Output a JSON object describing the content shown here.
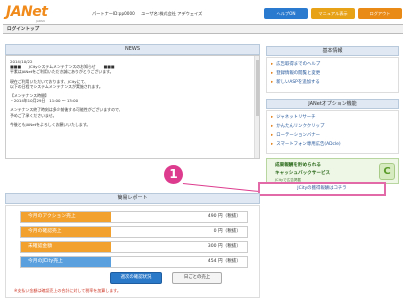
{
  "header": {
    "logo_main": "JANet",
    "logo_sub1": "JAPAN",
    "logo_sub2": "AFFILIATE NETWORK",
    "partner_label": "パートナーID:pp0000",
    "user_label": "ユーザ名:株式会社 アデウェイズ",
    "help_button": "ヘルプON",
    "manual_button": "マニュアル表示",
    "logout_button": "ログアウト"
  },
  "tabbar": {
    "active_tab": "ログイントップ"
  },
  "news": {
    "title": "NEWS",
    "lines": [
      "2014/10/22",
      "■■■　　JCityシステムメンテナンスのお知らせ　　■■■",
      "平素はJANetをご利用いただき誠にありがとうございます。",
      "",
      "現在ご利用いただいております、JCityにて、",
      "以下の日程でシステムメンテナンスが実施されます。",
      "",
      "【メンテナンス時間】",
      "・2014年10月29日　11:00 〜 13:00",
      "",
      "メンテナンス終了時刻は多少前後する可能性がございますので、",
      "予めご了承くださいませ。",
      "",
      "今後ともJANetをよろしくお願いいたします。"
    ]
  },
  "basic_info": {
    "title": "基本情報",
    "items": [
      "広告取得までのヘルプ",
      "登録情報の閲覧と変更",
      "新しいASPを追加する"
    ]
  },
  "option": {
    "title": "JANetオプション機能",
    "items": [
      "ジャネットリサーチ",
      "かんたんリンククリップ",
      "ローテーションバナー",
      "スマートフォン専用広告(ADcle)"
    ]
  },
  "banner": {
    "line1": "成果報酬を貯められる",
    "line2": "キャッシュバックサービス",
    "line3": "JCityで広告掲載",
    "coin_letter": "C"
  },
  "callout": {
    "number": "1",
    "text": "JCityの獲得報酬はコチラ"
  },
  "report": {
    "title": "簡易レポート",
    "rows": [
      {
        "label": "今月のアクション売上",
        "value": "490 円（税抜）"
      },
      {
        "label": "今月の確認売上",
        "value": "0 円（税抜）"
      },
      {
        "label": "未確認金額",
        "value": "300 円（税抜）"
      },
      {
        "label": "今月のJCity売上",
        "value": "454 円（税抜）"
      }
    ],
    "daily_button": "週次の確認状況",
    "monthly_button": "日ごとの売上",
    "note": "※支払い金額は確認売上の合計に対して税率を加算します。"
  },
  "colors": {
    "accent": "#f08a1a",
    "row_label": "#f2a12e",
    "row_label_last": "#5aa0df",
    "callout": "#dd3c8e"
  }
}
